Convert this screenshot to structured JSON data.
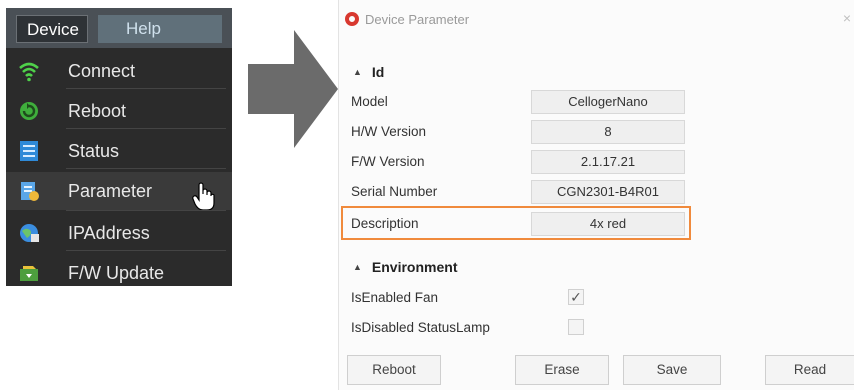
{
  "menubar": {
    "device": "Device",
    "help": "Help"
  },
  "menu_items": [
    {
      "label": "Connect",
      "icon": "wifi-icon"
    },
    {
      "label": "Reboot",
      "icon": "reboot-icon"
    },
    {
      "label": "Status",
      "icon": "status-icon"
    },
    {
      "label": "Parameter",
      "icon": "parameter-icon"
    },
    {
      "label": "IPAddress",
      "icon": "ipaddress-icon"
    },
    {
      "label": "F/W Update",
      "icon": "fw-update-icon"
    }
  ],
  "dialog": {
    "title": "Device Parameter",
    "close": "×",
    "sections": {
      "id": "Id",
      "environment": "Environment"
    },
    "params": [
      {
        "label": "Model",
        "value": "CellogerNano"
      },
      {
        "label": "H/W Version",
        "value": "8"
      },
      {
        "label": "F/W Version",
        "value": "2.1.17.21"
      },
      {
        "label": "Serial Number",
        "value": "CGN2301-B4R01"
      },
      {
        "label": "Description",
        "value": "4x red"
      }
    ],
    "env": [
      {
        "label": "IsEnabled Fan",
        "checked": true,
        "mark": "✓"
      },
      {
        "label": "IsDisabled StatusLamp",
        "checked": false,
        "mark": ""
      }
    ],
    "buttons": {
      "reboot": "Reboot",
      "erase": "Erase",
      "save": "Save",
      "read": "Read"
    }
  },
  "colors": {
    "accent_highlight": "#f08a3c",
    "title_ring": "#d8382f",
    "menu_bg": "#2b2b2b",
    "arrow": "#6b6b6b"
  }
}
